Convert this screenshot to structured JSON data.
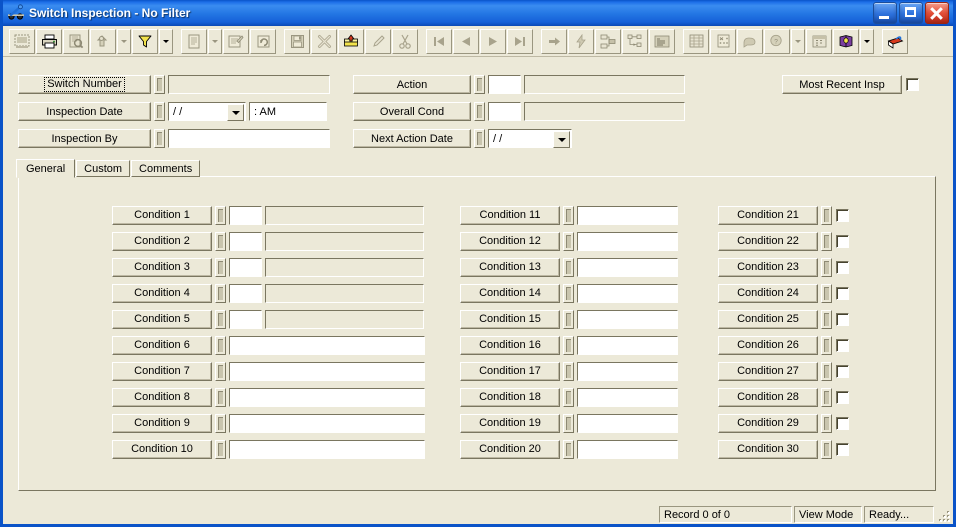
{
  "window": {
    "title": "Switch Inspection - No Filter",
    "icon": "switch-icon",
    "minimize_label": "Minimize",
    "maximize_label": "Maximize",
    "close_label": "Close"
  },
  "toolbar": {
    "buttons": [
      {
        "name": "select-records-icon",
        "enabled": false,
        "dropdown": false
      },
      {
        "name": "print-icon",
        "enabled": true,
        "dropdown": false
      },
      {
        "name": "print-preview-icon",
        "enabled": false,
        "dropdown": false
      },
      {
        "name": "find-icon",
        "enabled": false,
        "dropdown": true
      },
      {
        "name": "filter-icon",
        "enabled": true,
        "dropdown": true
      },
      {
        "name": "report-icon",
        "enabled": false,
        "dropdown": true
      },
      {
        "name": "edit-record-icon",
        "enabled": false,
        "dropdown": false
      },
      {
        "name": "refresh-icon",
        "enabled": false,
        "dropdown": false
      },
      {
        "name": "save-icon",
        "enabled": false,
        "dropdown": false
      },
      {
        "name": "delete-icon",
        "enabled": false,
        "dropdown": false
      },
      {
        "name": "new-record-icon",
        "enabled": true,
        "dropdown": false
      },
      {
        "name": "edit-pencil-icon",
        "enabled": false,
        "dropdown": false
      },
      {
        "name": "cut-icon",
        "enabled": false,
        "dropdown": false
      },
      {
        "name": "first-record-icon",
        "enabled": false,
        "dropdown": false
      },
      {
        "name": "previous-record-icon",
        "enabled": false,
        "dropdown": false
      },
      {
        "name": "next-record-icon",
        "enabled": false,
        "dropdown": false
      },
      {
        "name": "last-record-icon",
        "enabled": false,
        "dropdown": false
      },
      {
        "name": "goto-record-icon",
        "enabled": false,
        "dropdown": false
      },
      {
        "name": "lightning-icon",
        "enabled": false,
        "dropdown": false
      },
      {
        "name": "hierarchy-icon",
        "enabled": false,
        "dropdown": false
      },
      {
        "name": "tree-view-icon",
        "enabled": false,
        "dropdown": false
      },
      {
        "name": "list-view-icon",
        "enabled": false,
        "dropdown": false
      },
      {
        "name": "grid-view-icon",
        "enabled": false,
        "dropdown": false
      },
      {
        "name": "calculator-icon",
        "enabled": false,
        "dropdown": false
      },
      {
        "name": "attachment-icon",
        "enabled": false,
        "dropdown": false
      },
      {
        "name": "note-icon",
        "enabled": false,
        "dropdown": false
      },
      {
        "name": "map-icon",
        "enabled": false,
        "dropdown": true
      },
      {
        "name": "calendar-icon",
        "enabled": false,
        "dropdown": false
      },
      {
        "name": "help-book-icon",
        "enabled": true,
        "dropdown": true
      },
      {
        "name": "exit-icon",
        "enabled": true,
        "dropdown": false
      }
    ]
  },
  "header": {
    "left": [
      {
        "label": "Switch Number",
        "value": "",
        "kind": "text-disabled",
        "focused": true
      },
      {
        "label": "Inspection Date",
        "value": "/ /",
        "time_value": ":  AM",
        "kind": "date-time",
        "focused": false
      },
      {
        "label": "Inspection By",
        "value": "",
        "kind": "text",
        "focused": false
      }
    ],
    "middle": [
      {
        "label": "Action",
        "code": "",
        "value": "",
        "kind": "code-desc"
      },
      {
        "label": "Overall Cond",
        "code": "",
        "value": "",
        "kind": "code-desc"
      },
      {
        "label": "Next Action Date",
        "value": "/ /",
        "kind": "date"
      }
    ],
    "right": {
      "button_label": "Most Recent Insp",
      "checkbox_checked": false
    }
  },
  "tabs": [
    {
      "label": "General",
      "active": true
    },
    {
      "label": "Custom",
      "active": false
    },
    {
      "label": "Comments",
      "active": false
    }
  ],
  "conditions": {
    "column1": [
      {
        "label": "Condition 1",
        "code": "",
        "desc": "",
        "kind": "code-desc"
      },
      {
        "label": "Condition 2",
        "code": "",
        "desc": "",
        "kind": "code-desc"
      },
      {
        "label": "Condition 3",
        "code": "",
        "desc": "",
        "kind": "code-desc"
      },
      {
        "label": "Condition 4",
        "code": "",
        "desc": "",
        "kind": "code-desc"
      },
      {
        "label": "Condition 5",
        "code": "",
        "desc": "",
        "kind": "code-desc"
      },
      {
        "label": "Condition 6",
        "value": "",
        "kind": "text"
      },
      {
        "label": "Condition 7",
        "value": "",
        "kind": "text"
      },
      {
        "label": "Condition 8",
        "value": "",
        "kind": "text"
      },
      {
        "label": "Condition 9",
        "value": "",
        "kind": "text"
      },
      {
        "label": "Condition 10",
        "value": "",
        "kind": "text"
      }
    ],
    "column2": [
      {
        "label": "Condition 11",
        "value": "",
        "kind": "text"
      },
      {
        "label": "Condition 12",
        "value": "",
        "kind": "text"
      },
      {
        "label": "Condition 13",
        "value": "",
        "kind": "text"
      },
      {
        "label": "Condition 14",
        "value": "",
        "kind": "text"
      },
      {
        "label": "Condition 15",
        "value": "",
        "kind": "text"
      },
      {
        "label": "Condition 16",
        "value": "",
        "kind": "text"
      },
      {
        "label": "Condition 17",
        "value": "",
        "kind": "text"
      },
      {
        "label": "Condition 18",
        "value": "",
        "kind": "text"
      },
      {
        "label": "Condition 19",
        "value": "",
        "kind": "text"
      },
      {
        "label": "Condition 20",
        "value": "",
        "kind": "text"
      }
    ],
    "column3": [
      {
        "label": "Condition 21",
        "checked": false,
        "kind": "checkbox"
      },
      {
        "label": "Condition 22",
        "checked": false,
        "kind": "checkbox"
      },
      {
        "label": "Condition 23",
        "checked": false,
        "kind": "checkbox"
      },
      {
        "label": "Condition 24",
        "checked": false,
        "kind": "checkbox"
      },
      {
        "label": "Condition 25",
        "checked": false,
        "kind": "checkbox"
      },
      {
        "label": "Condition 26",
        "checked": false,
        "kind": "checkbox"
      },
      {
        "label": "Condition 27",
        "checked": false,
        "kind": "checkbox"
      },
      {
        "label": "Condition 28",
        "checked": false,
        "kind": "checkbox"
      },
      {
        "label": "Condition 29",
        "checked": false,
        "kind": "checkbox"
      },
      {
        "label": "Condition 30",
        "checked": false,
        "kind": "checkbox"
      }
    ]
  },
  "statusbar": {
    "record": "Record 0 of 0",
    "mode": "View Mode",
    "state": "Ready..."
  },
  "colors": {
    "window_face": "#ECE9D8",
    "title_active": "#1C6FE8",
    "title_text": "#FFFFFF",
    "close_button": "#E2503A",
    "field_bg": "#FFFFFF",
    "field_disabled_bg": "#ECE9D8",
    "border_shadow": "#7A7660",
    "border_light": "#FFFFFF",
    "filter_icon": "#F2E34C",
    "help_book": "#7B3FA0"
  }
}
